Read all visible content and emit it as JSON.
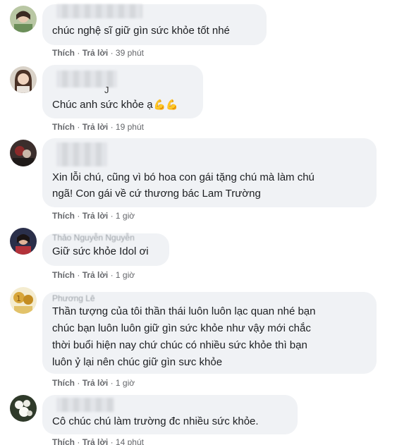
{
  "labels": {
    "like": "Thích",
    "reply": "Trả lời",
    "sep": "·"
  },
  "comments": [
    {
      "text": "chúc nghệ sĩ giữ gìn sức khỏe tốt nhé",
      "time": "39 phút",
      "avatar_icon": "user-photo-avatar"
    },
    {
      "name_fragment": "J",
      "text": "Chúc anh sức khỏe ạ",
      "emoji": "💪💪",
      "time": "19 phút",
      "avatar_icon": "user-photo-avatar"
    },
    {
      "text_line1": "Xin lỗi chú, cũng vì bó hoa con gái tặng chú mà làm chú",
      "text_line2": "ngã! Con gái về cứ thương bác Lam Trường",
      "time": "1 giờ",
      "avatar_icon": "user-photo-avatar"
    },
    {
      "name_faint": "Thảo Nguyễn Nguyễn",
      "text": "Giữ sức khỏe Idol ơi",
      "time": "1 giờ",
      "avatar_icon": "user-photo-avatar"
    },
    {
      "name_faint": "Phương Lê",
      "text_line1": "Thần tượng của tôi thần thái luôn luôn lạc quan nhé bạn",
      "text_line2": "chúc bạn luôn luôn giữ gìn sức khỏe như vậy mới chắc",
      "text_line3": "thời buổi hiện nay chứ chúc có nhiều sức khỏe thì bạn",
      "text_line4": "luôn ỷ lại nên chúc giữ gìn sưc khỏe",
      "time": "1 giờ",
      "avatar_icon": "user-photo-avatar"
    },
    {
      "text": "Cô chúc chú làm trường đc nhiều sức khỏe.",
      "time": "14 phút",
      "avatar_icon": "flower-photo-avatar"
    }
  ]
}
